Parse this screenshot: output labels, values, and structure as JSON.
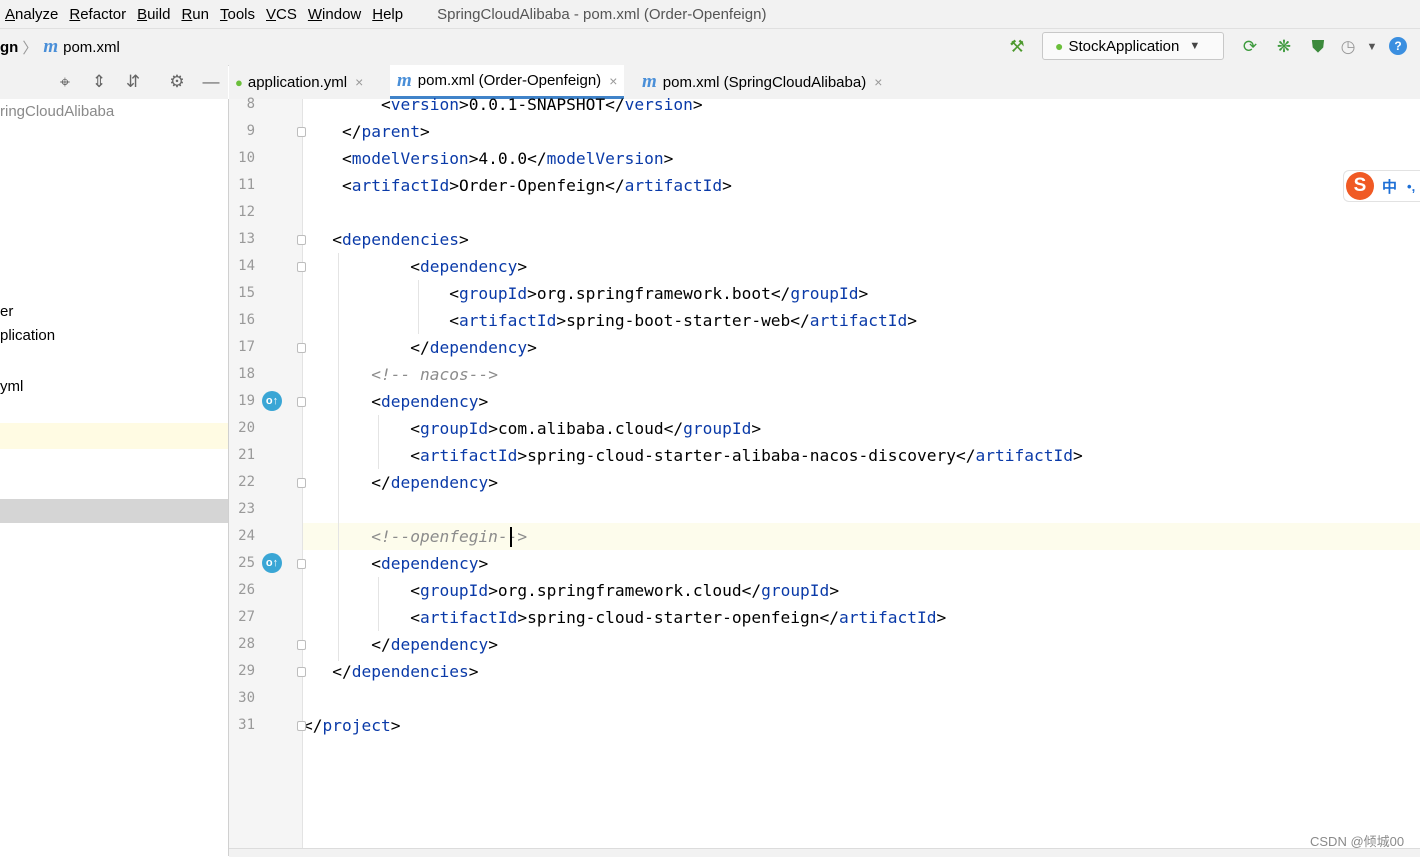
{
  "menu": [
    {
      "label": "Analyze",
      "u": "A",
      "rest": "nalyze"
    },
    {
      "label": "Refactor",
      "u": "R",
      "rest": "efactor"
    },
    {
      "label": "Build",
      "u": "B",
      "rest": "uild"
    },
    {
      "label": "Run",
      "u": "R",
      "rest": "un"
    },
    {
      "label": "Tools",
      "u": "T",
      "rest": "ools"
    },
    {
      "label": "VCS",
      "u": "V",
      "rest": "CS"
    },
    {
      "label": "Window",
      "u": "W",
      "rest": "indow"
    },
    {
      "label": "Help",
      "u": "H",
      "rest": "elp"
    }
  ],
  "window_title": "SpringCloudAlibaba - pom.xml (Order-Openfeign)",
  "breadcrumb": {
    "parent": "gn",
    "file": "pom.xml",
    "m": "m"
  },
  "run_config": "StockApplication",
  "project_tree": [
    "ringCloudAlibaba",
    "er",
    "plication",
    "yml"
  ],
  "tabs": [
    {
      "label": "application.yml",
      "close": "×"
    },
    {
      "label": "pom.xml (Order-Openfeign)",
      "close": "×",
      "m": "m"
    },
    {
      "label": "pom.xml (SpringCloudAlibaba)",
      "close": "×",
      "m": "m"
    }
  ],
  "code": [
    {
      "n": "8",
      "indent": "        ",
      "parts": [
        [
          "t",
          "<"
        ],
        [
          "g",
          "version"
        ],
        [
          "t",
          ">0.0.1-SNAPSHOT</"
        ],
        [
          "g",
          "version"
        ],
        [
          "t",
          ">"
        ]
      ]
    },
    {
      "n": "9",
      "indent": "    ",
      "parts": [
        [
          "t",
          "</"
        ],
        [
          "g",
          "parent"
        ],
        [
          "t",
          ">"
        ]
      ]
    },
    {
      "n": "10",
      "indent": "    ",
      "parts": [
        [
          "t",
          "<"
        ],
        [
          "g",
          "modelVersion"
        ],
        [
          "t",
          ">4.0.0</"
        ],
        [
          "g",
          "modelVersion"
        ],
        [
          "t",
          ">"
        ]
      ]
    },
    {
      "n": "11",
      "indent": "    ",
      "parts": [
        [
          "t",
          "<"
        ],
        [
          "g",
          "artifactId"
        ],
        [
          "t",
          ">Order-Openfeign</"
        ],
        [
          "g",
          "artifactId"
        ],
        [
          "t",
          ">"
        ]
      ]
    },
    {
      "n": "12",
      "indent": "",
      "parts": []
    },
    {
      "n": "13",
      "indent": "   ",
      "parts": [
        [
          "t",
          "<"
        ],
        [
          "g",
          "dependencies"
        ],
        [
          "t",
          ">"
        ]
      ]
    },
    {
      "n": "14",
      "indent": "           ",
      "parts": [
        [
          "t",
          "<"
        ],
        [
          "g",
          "dependency"
        ],
        [
          "t",
          ">"
        ]
      ]
    },
    {
      "n": "15",
      "indent": "               ",
      "parts": [
        [
          "t",
          "<"
        ],
        [
          "g",
          "groupId"
        ],
        [
          "t",
          ">org.springframework.boot</"
        ],
        [
          "g",
          "groupId"
        ],
        [
          "t",
          ">"
        ]
      ]
    },
    {
      "n": "16",
      "indent": "               ",
      "parts": [
        [
          "t",
          "<"
        ],
        [
          "g",
          "artifactId"
        ],
        [
          "t",
          ">spring-boot-starter-web</"
        ],
        [
          "g",
          "artifactId"
        ],
        [
          "t",
          ">"
        ]
      ]
    },
    {
      "n": "17",
      "indent": "           ",
      "parts": [
        [
          "t",
          "</"
        ],
        [
          "g",
          "dependency"
        ],
        [
          "t",
          ">"
        ]
      ]
    },
    {
      "n": "18",
      "indent": "       ",
      "parts": [
        [
          "c",
          "<!-- "
        ],
        [
          "cs",
          "nacos"
        ],
        [
          "c",
          "-->"
        ]
      ]
    },
    {
      "n": "19",
      "indent": "       ",
      "parts": [
        [
          "t",
          "<"
        ],
        [
          "g",
          "dependency"
        ],
        [
          "t",
          ">"
        ]
      ]
    },
    {
      "n": "20",
      "indent": "           ",
      "parts": [
        [
          "t",
          "<"
        ],
        [
          "g",
          "groupId"
        ],
        [
          "t",
          ">com.alibaba.cloud</"
        ],
        [
          "g",
          "groupId"
        ],
        [
          "t",
          ">"
        ]
      ]
    },
    {
      "n": "21",
      "indent": "           ",
      "parts": [
        [
          "t",
          "<"
        ],
        [
          "g",
          "artifactId"
        ],
        [
          "t",
          ">spring-cloud-starter-alibaba-nacos-discovery</"
        ],
        [
          "g",
          "artifactId"
        ],
        [
          "t",
          ">"
        ]
      ]
    },
    {
      "n": "22",
      "indent": "       ",
      "parts": [
        [
          "t",
          "</"
        ],
        [
          "g",
          "dependency"
        ],
        [
          "t",
          ">"
        ]
      ]
    },
    {
      "n": "23",
      "indent": "",
      "parts": []
    },
    {
      "n": "24",
      "indent": "       ",
      "parts": [
        [
          "c",
          "<!--"
        ],
        [
          "cs",
          "openfegin"
        ],
        [
          "c",
          "-->"
        ]
      ]
    },
    {
      "n": "25",
      "indent": "       ",
      "parts": [
        [
          "t",
          "<"
        ],
        [
          "g",
          "dependency"
        ],
        [
          "t",
          ">"
        ]
      ]
    },
    {
      "n": "26",
      "indent": "           ",
      "parts": [
        [
          "t",
          "<"
        ],
        [
          "g",
          "groupId"
        ],
        [
          "t",
          ">org.springframework.cloud</"
        ],
        [
          "g",
          "groupId"
        ],
        [
          "t",
          ">"
        ]
      ]
    },
    {
      "n": "27",
      "indent": "           ",
      "parts": [
        [
          "t",
          "<"
        ],
        [
          "g",
          "artifactId"
        ],
        [
          "t",
          ">spring-cloud-starter-openfeign</"
        ],
        [
          "g",
          "artifactId"
        ],
        [
          "t",
          ">"
        ]
      ]
    },
    {
      "n": "28",
      "indent": "       ",
      "parts": [
        [
          "t",
          "</"
        ],
        [
          "g",
          "dependency"
        ],
        [
          "t",
          ">"
        ]
      ]
    },
    {
      "n": "29",
      "indent": "   ",
      "parts": [
        [
          "t",
          "</"
        ],
        [
          "g",
          "dependencies"
        ],
        [
          "t",
          ">"
        ]
      ]
    },
    {
      "n": "30",
      "indent": "",
      "parts": []
    },
    {
      "n": "31",
      "indent": "",
      "parts": [
        [
          "t",
          "</"
        ],
        [
          "g",
          "project"
        ],
        [
          "t",
          ">"
        ]
      ]
    }
  ],
  "ime": {
    "logo": "S",
    "lang": "中",
    "punct": "•,"
  },
  "watermark": "CSDN @倾城00",
  "colors": {
    "tag": "#0a3aa8",
    "comment": "#8c8c8c",
    "accent": "#4083c9",
    "ime": "#f05a24"
  }
}
